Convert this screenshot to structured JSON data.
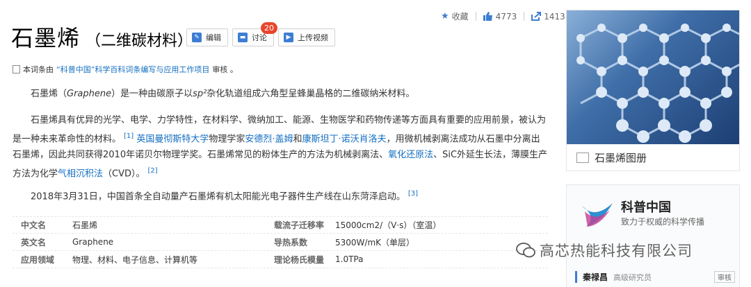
{
  "stats": {
    "favorite_label": "收藏",
    "likes": "4773",
    "shares": "1413"
  },
  "title": {
    "main": "石墨烯",
    "sub": "（二维碳材料）"
  },
  "buttons": {
    "edit": "编辑",
    "discuss": "讨论",
    "discuss_badge": "20",
    "upload_video": "上传视频"
  },
  "review": {
    "prefix": "本词条由",
    "link": "“科普中国”科学百科词条编写与应用工作项目",
    "suffix": "审核 。"
  },
  "paragraphs": {
    "p1": {
      "a": "石墨烯（",
      "italic1": "Graphene",
      "b": "）是一种由碳原子以",
      "italic2": "sp²",
      "c": "杂化轨道组成六角型呈蜂巢晶格的二维碳纳米材料。"
    },
    "p2": {
      "t1": "石墨烯具有优异的光学、电学、力学特性，在材料学、微纳加工、能源、生物医学和药物传递等方面具有重要的应用前景，被认为是一种未来革命性的材料。",
      "ref1": "[1]",
      "link1": "英国曼彻斯特大学",
      "t2": "物理学家",
      "link2": "安德烈·盖姆",
      "t3": "和",
      "link3": "康斯坦丁·诺沃肖洛夫",
      "t4": "，用微机械剥离法成功从石墨中分离出石墨烯，因此共同获得2010年诺贝尔物理学奖。石墨烯常见的粉体生产的方法为机械剥离法、",
      "link4": "氧化还原法",
      "t5": "、SiC外延生长法，薄膜生产方法为化学",
      "link5": "气相沉积法",
      "t6": "（CVD）。",
      "ref2": "[2]"
    },
    "p3": {
      "text": "2018年3月31日，中国首条全自动量产石墨烯有机太阳能光电子器件生产线在山东菏泽启动。",
      "ref": "[3]"
    }
  },
  "info_table": [
    {
      "k1": "中文名",
      "v1": "石墨烯",
      "k2": "载流子迁移率",
      "v2": "15000cm2/（V·s）（室温）"
    },
    {
      "k1": "英文名",
      "v1": "Graphene",
      "k2": "导热系数",
      "v2": "5300W/mK（单层）"
    },
    {
      "k1": "应用领域",
      "v1": "物理、材料、电子信息、计算机等",
      "k2": "理论杨氏模量",
      "v2": "1.0TPa"
    }
  ],
  "album": {
    "caption": "石墨烯图册"
  },
  "kepu": {
    "name": "科普中国",
    "desc": "致力于权威的科学传播",
    "expert_name": "秦禄昌",
    "expert_title": "高级研究员",
    "expert_tag": "审核"
  },
  "watermark": {
    "text": "高芯热能科技有限公司"
  },
  "colors": {
    "link": "#136ec2",
    "accent_blue": "#3d7dd3",
    "badge_red": "#e8462c"
  },
  "icons": [
    "star-icon",
    "thumbs-up-icon",
    "share-icon",
    "edit-icon",
    "discuss-icon",
    "upload-video-icon",
    "document-icon",
    "album-icon",
    "wechat-icon"
  ]
}
